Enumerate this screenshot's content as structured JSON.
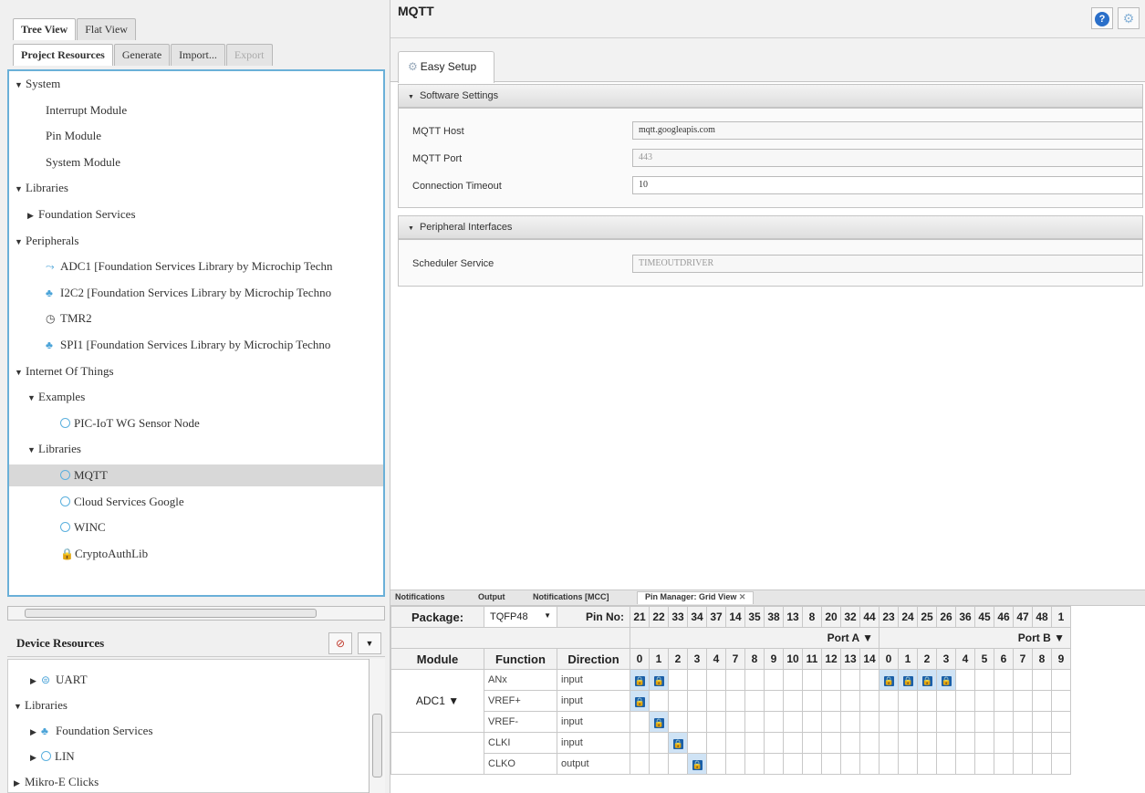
{
  "left": {
    "top_tabs": [
      "Tree View",
      "Flat View"
    ],
    "sub_tabs": [
      "Project Resources",
      "Generate",
      "Import...",
      "Export"
    ],
    "tree": [
      {
        "label": "System",
        "level": 0,
        "tri": "▼"
      },
      {
        "label": "Interrupt Module",
        "level": 1
      },
      {
        "label": "Pin Module",
        "level": 1
      },
      {
        "label": "System Module",
        "level": 1
      },
      {
        "label": "Libraries",
        "level": 0,
        "tri": "▼"
      },
      {
        "label": "Foundation Services",
        "level": 1,
        "tri": "▶"
      },
      {
        "label": "Peripherals",
        "level": 0,
        "tri": "▼"
      },
      {
        "label": "ADC1 [Foundation Services Library by Microchip Techn",
        "level": 1,
        "icon": "adc-icon"
      },
      {
        "label": "I2C2 [Foundation Services Library by Microchip Techno",
        "level": 1,
        "icon": "bus-icon"
      },
      {
        "label": "TMR2",
        "level": 1,
        "icon": "timer-icon"
      },
      {
        "label": "SPI1 [Foundation Services Library by Microchip Techno",
        "level": 1,
        "icon": "bus-icon"
      },
      {
        "label": "Internet Of Things",
        "level": 0,
        "tri": "▼"
      },
      {
        "label": "Examples",
        "level": 1,
        "tri": "▼"
      },
      {
        "label": "PIC-IoT WG Sensor Node",
        "level": 2,
        "icon": "circle-icon"
      },
      {
        "label": "Libraries",
        "level": 1,
        "tri": "▼"
      },
      {
        "label": "MQTT",
        "level": 2,
        "icon": "circle-icon",
        "selected": true
      },
      {
        "label": "Cloud Services Google",
        "level": 2,
        "icon": "circle-icon"
      },
      {
        "label": "WINC",
        "level": 2,
        "icon": "circle-icon"
      },
      {
        "label": "CryptoAuthLib",
        "level": 2,
        "icon": "lock-icon"
      }
    ],
    "device_resources_title": "Device Resources",
    "device_tree": [
      {
        "label": "UART",
        "level": 1,
        "tri": "▶",
        "icon": "uart-icon"
      },
      {
        "label": "Libraries",
        "level": 0,
        "tri": "▼"
      },
      {
        "label": "Foundation Services",
        "level": 1,
        "tri": "▶",
        "icon": "bus-icon"
      },
      {
        "label": "LIN",
        "level": 1,
        "tri": "▶",
        "icon": "circle-icon"
      },
      {
        "label": "Mikro-E Clicks",
        "level": 0,
        "tri": "▶"
      }
    ]
  },
  "right": {
    "title": "MQTT",
    "tab": "Easy Setup",
    "software_section": "Software Settings",
    "fields": [
      {
        "label": "MQTT Host",
        "value": "mqtt.googleapis.com",
        "disabled": false
      },
      {
        "label": "MQTT Port",
        "value": "443",
        "disabled": true
      },
      {
        "label": "Connection Timeout",
        "value": "10",
        "disabled": false
      }
    ],
    "peripheral_section": "Peripheral Interfaces",
    "scheduler_label": "Scheduler Service",
    "scheduler_value": "TIMEOUTDRIVER"
  },
  "bottom": {
    "tabs": [
      "Notifications",
      "Output",
      "Notifications [MCC]",
      "Pin Manager: Grid View"
    ],
    "package_label": "Package:",
    "package_value": "TQFP48",
    "pinno_label": "Pin No:",
    "pins": [
      "21",
      "22",
      "33",
      "34",
      "37",
      "14",
      "35",
      "38",
      "13",
      "8",
      "20",
      "32",
      "44",
      "23",
      "24",
      "25",
      "26",
      "36",
      "45",
      "46",
      "47",
      "48",
      "1"
    ],
    "port_a": "Port A ▼",
    "port_b": "Port B ▼",
    "col_module": "Module",
    "col_function": "Function",
    "col_direction": "Direction",
    "bits": [
      "0",
      "1",
      "2",
      "3",
      "4",
      "7",
      "8",
      "9",
      "10",
      "11",
      "12",
      "13",
      "14",
      "0",
      "1",
      "2",
      "3",
      "4",
      "5",
      "6",
      "7",
      "8",
      "9"
    ],
    "module_adc": "ADC1 ▼",
    "rows": [
      {
        "function": "ANx",
        "direction": "input",
        "locks": [
          0,
          1,
          13,
          14,
          15,
          16
        ]
      },
      {
        "function": "VREF+",
        "direction": "input",
        "locks": [
          0
        ]
      },
      {
        "function": "VREF-",
        "direction": "input",
        "locks": [
          1
        ]
      },
      {
        "function": "CLKI",
        "direction": "input",
        "locks": [
          2
        ]
      },
      {
        "function": "CLKO",
        "direction": "output",
        "locks": [
          3
        ]
      }
    ]
  }
}
